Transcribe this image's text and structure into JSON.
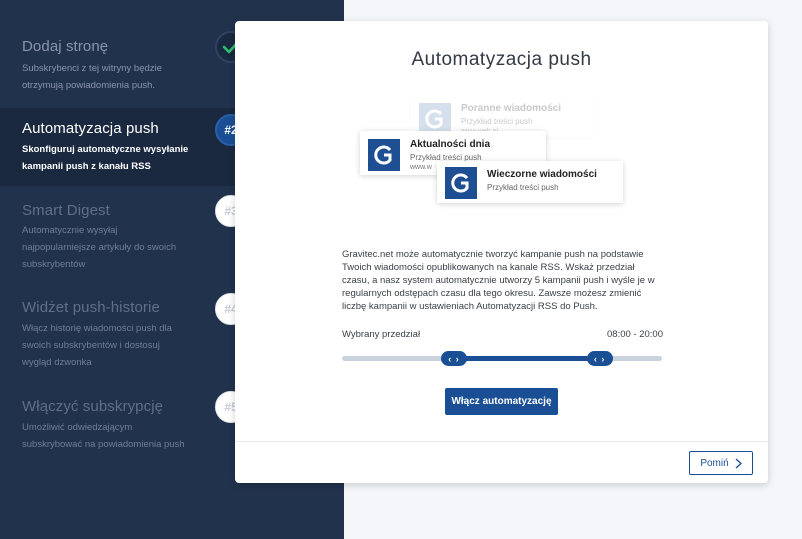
{
  "sidebar": {
    "steps": [
      {
        "title": "Dodaj stronę",
        "desc": "Subskrybenci z tej witryny będzie otrzymują powiadomienia push.",
        "badge": "✓",
        "state": "done"
      },
      {
        "title": "Automatyzacja push",
        "desc": "Skonfiguruj automatyczne wysyłanie kampanii push z kanału RSS",
        "badge": "#2",
        "state": "active"
      },
      {
        "title": "Smart Digest",
        "desc": "Automatycznie wysyłaj najpopularniejsze artykuły do swoich subskrybentów",
        "badge": "#3",
        "state": "pending"
      },
      {
        "title": "Widżet push-historie",
        "desc": "Włącz historię wiadomości push dla swoich subskrybentów i dostosuj wygląd dzwonka",
        "badge": "#4",
        "state": "pending"
      },
      {
        "title": "Włączyć subskrypcję",
        "desc": "Umożliwić odwiedzającym subskrybować na powiadomienia push",
        "badge": "#5",
        "state": "pending"
      }
    ]
  },
  "card": {
    "title": "Automatyzacja push",
    "notifications": [
      {
        "title": "Poranne wiadomości",
        "body": "Przykład treści push",
        "url": "www.web.pl"
      },
      {
        "title": "Aktualności dnia",
        "body": "Przykład treści push",
        "url": "www.w"
      },
      {
        "title": "Wieczorne wiadomości",
        "body": "Przykład treści push",
        "url": ""
      }
    ],
    "description": "Gravitec.net może automatycznie tworzyć kampanie push na podstawie Twoich wiadomości opublikowanych na kanale RSS. Wskaż przedział czasu, a nasz system automatycznie utworzy 5 kampanii push i wyśle je w regularnych odstępach czasu dla tego okresu. Zawsze możesz zmienić liczbę kampanii w ustawieniach Automatyzacji RSS do Push.",
    "range_label": "Wybrany przedział",
    "range_value": "08:00 - 20:00",
    "range_start_fraction": 0.35,
    "range_end_fraction": 0.805,
    "handle_glyph": "‹ ›",
    "primary_button": "Włącz automatyzację",
    "skip_button": "Pomiń",
    "skip_icon": "chevron-right-icon"
  },
  "colors": {
    "sidebar_bg": "#21324d",
    "accent": "#1a4f96",
    "check": "#2fbf71"
  }
}
